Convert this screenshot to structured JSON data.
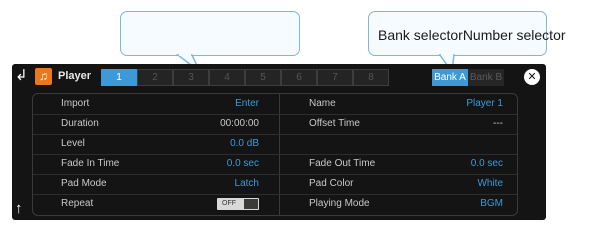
{
  "callouts": {
    "number_selector_text": "",
    "bank_selector_text": "Bank selectorNumber selector"
  },
  "header": {
    "title": "Player",
    "numbers": [
      "1",
      "2",
      "3",
      "4",
      "5",
      "6",
      "7",
      "8"
    ],
    "banks": [
      "Bank A",
      "Bank B"
    ]
  },
  "colors": {
    "accent": "#3d9ad8",
    "app_icon": "#e9791f",
    "panel": "#141414"
  },
  "icons": {
    "back": "return-arrow-icon",
    "app": "music-note-icon",
    "close": "close-icon",
    "up": "up-arrow-icon"
  },
  "params": {
    "left": [
      {
        "label": "Import",
        "value": "Enter"
      },
      {
        "label": "Duration",
        "value": "00:00:00"
      },
      {
        "label": "Level",
        "value": "0.0 dB"
      },
      {
        "label": "Fade In Time",
        "value": "0.0 sec"
      },
      {
        "label": "Pad Mode",
        "value": "Latch"
      },
      {
        "label": "Repeat",
        "value": "OFF"
      }
    ],
    "right": [
      {
        "label": "Name",
        "value": "Player 1"
      },
      {
        "label": "Offset Time",
        "value": "---"
      },
      {
        "label": "",
        "value": ""
      },
      {
        "label": "Fade Out Time",
        "value": "0.0 sec"
      },
      {
        "label": "Pad Color",
        "value": "White"
      },
      {
        "label": "Playing Mode",
        "value": "BGM"
      }
    ]
  }
}
